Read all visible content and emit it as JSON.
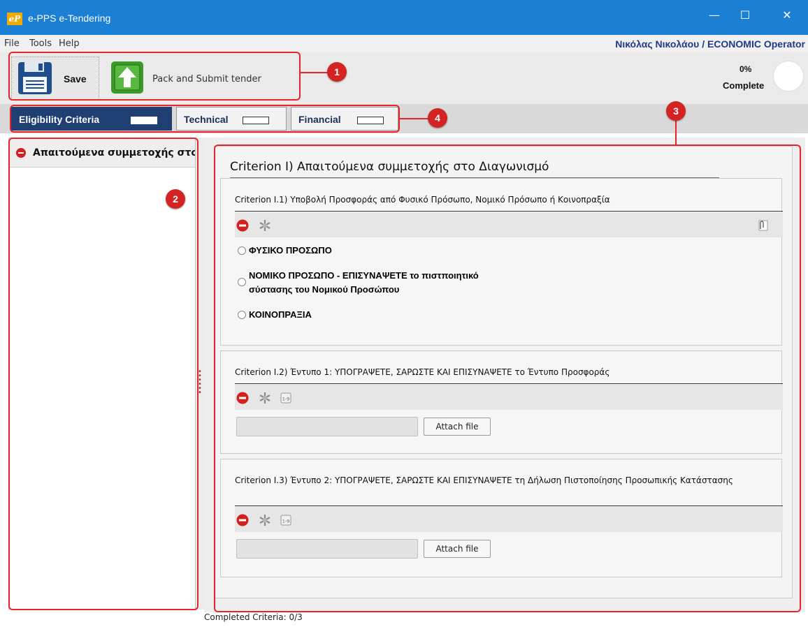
{
  "window": {
    "logo_text": "eP",
    "title": "e-PPS e-Tendering",
    "controls": {
      "minimize": "—",
      "maximize": "☐",
      "close": "✕"
    }
  },
  "menu": {
    "items": [
      {
        "label": "File"
      },
      {
        "label": "Tools"
      },
      {
        "label": "Help"
      }
    ],
    "user": "Νικόλας Νικολάου / ECONOMIC Operator"
  },
  "toolbar": {
    "save_label": "Save",
    "pack_label": "Pack and Submit tender",
    "progress_percent": "0%",
    "progress_label": "Complete",
    "progress_value": 0
  },
  "tabs": [
    {
      "label": "Eligibility Criteria",
      "active": true
    },
    {
      "label": "Technical",
      "active": false
    },
    {
      "label": "Financial",
      "active": false
    }
  ],
  "sidebar": {
    "items": [
      {
        "label": "Απαιτούμενα συμμετοχής στο Διαγωνισμό",
        "icon": "remove-icon"
      }
    ]
  },
  "main": {
    "title": "Criterion I) Απαιτούμενα συμμετοχής στο Διαγωνισμό",
    "criteria": [
      {
        "title": "Criterion I.1) Υποβολή Προσφοράς από Φυσικό Πρόσωπο, Νομικό Πρόσωπο ή Κοινοπραξία",
        "options": [
          "ΦΥΣΙΚΟ ΠΡΟΣΩΠΟ",
          "ΝΟΜΙΚΟ ΠΡΟΣΩΠΟ - ΕΠΙΣΥΝΑΨΕΤΕ το πιστποιητικό",
          "σύστασης του Νομικού Προσώπου",
          "ΚΟΙΝΟΠΡΑΞΙΑ"
        ]
      },
      {
        "title": "Criterion I.2) Έντυπο 1: ΥΠΟΓΡΑΨΕΤΕ, ΣΑΡΩΣΤΕ ΚΑΙ ΕΠΙΣΥΝΑΨΕΤΕ το Έντυπο Προσφοράς",
        "file_value": "",
        "attach_label": "Attach file"
      },
      {
        "title": "Criterion I.3) Έντυπο 2: ΥΠΟΓΡΑΨΕΤΕ, ΣΑΡΩΣΤΕ ΚΑΙ ΕΠΙΣΥΝΑΨΕΤΕ τη Δήλωση Πιστοποίησης Προσωπικής Κατάστασης",
        "file_value": "",
        "attach_label": "Attach file"
      }
    ]
  },
  "status": "Completed Criteria: 0/3",
  "annotations": [
    "1",
    "2",
    "3",
    "4"
  ],
  "colors": {
    "titlebar": "#1b7fd4",
    "active_tab": "#1f3f73",
    "annotation": "#e8242a",
    "user_text": "#1f3a8a"
  }
}
